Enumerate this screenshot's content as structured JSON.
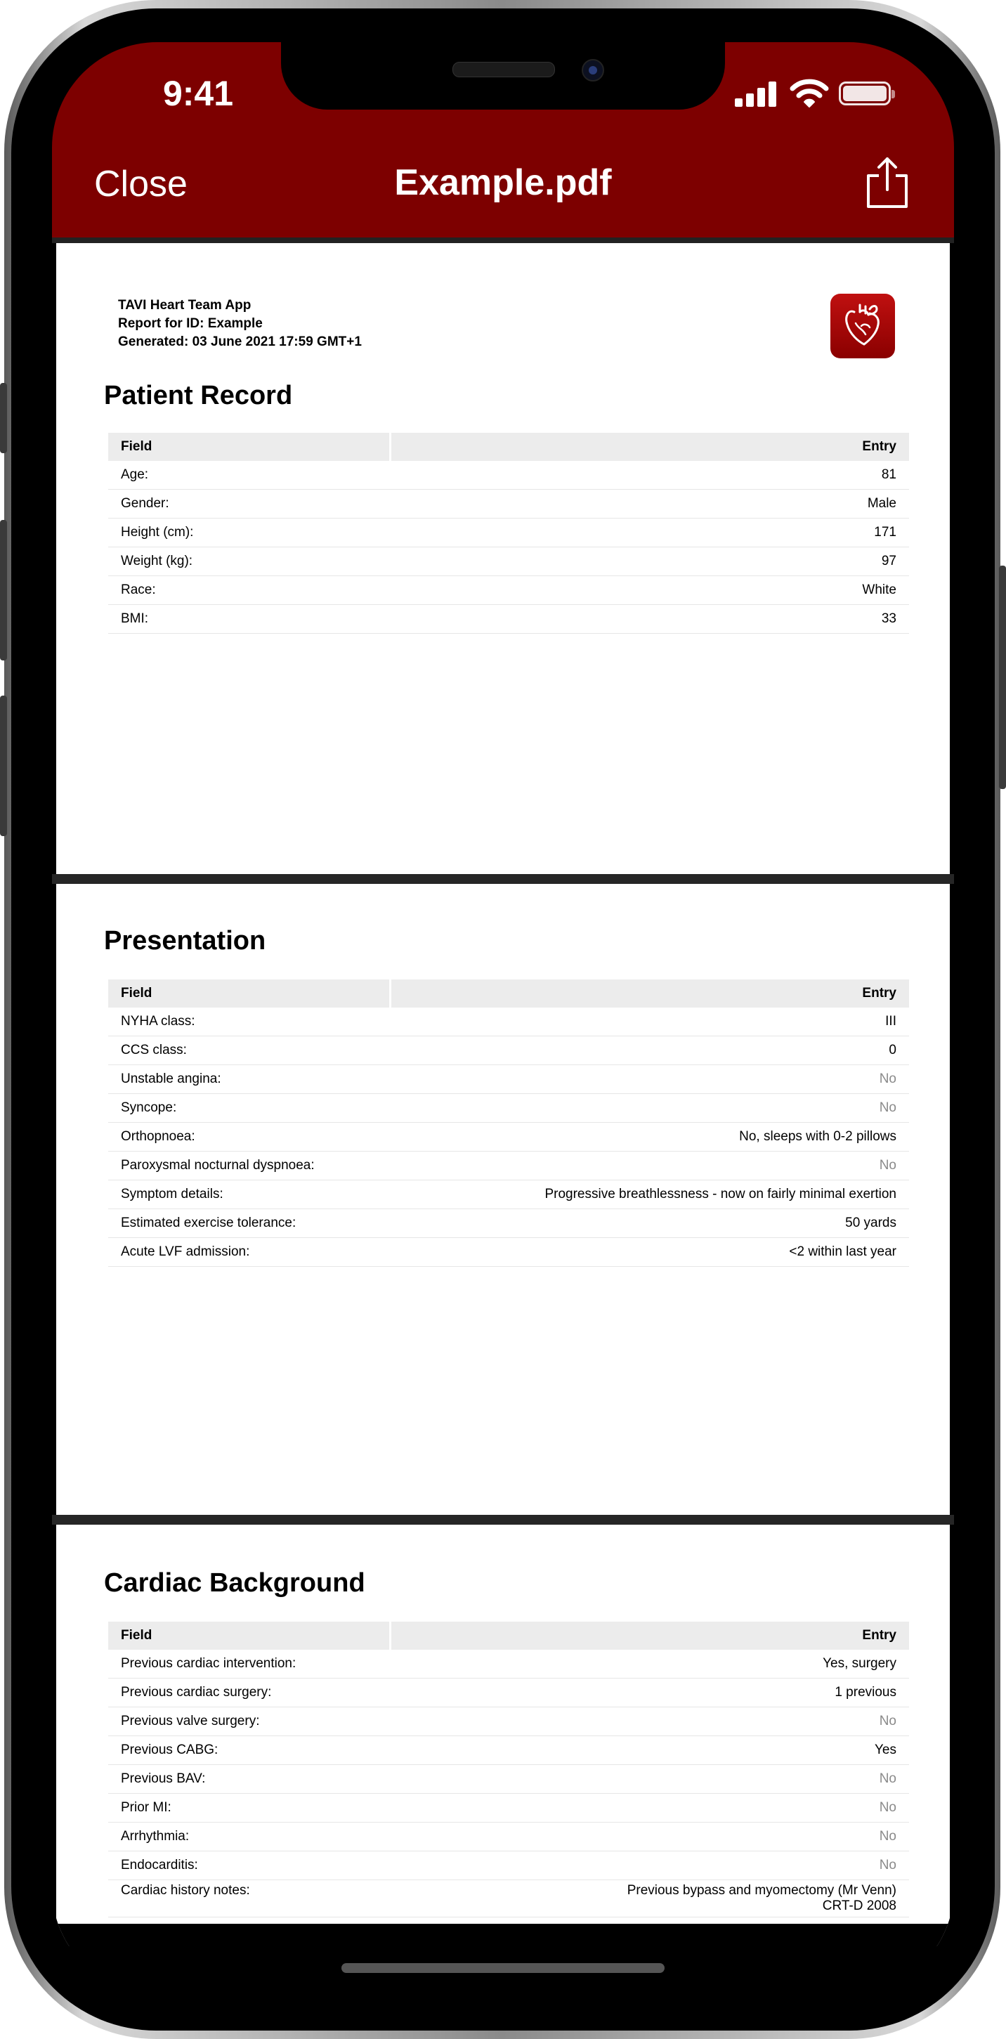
{
  "status_bar": {
    "time": "9:41"
  },
  "nav": {
    "close_label": "Close",
    "title": "Example.pdf"
  },
  "report": {
    "app_name": "TAVI Heart Team App",
    "report_for": "Report for ID: Example",
    "generated": "Generated: 03 June 2021 17:59 GMT+1"
  },
  "columns": {
    "field": "Field",
    "entry": "Entry"
  },
  "sections": [
    {
      "title": "Patient Record",
      "rows": [
        {
          "field": "Age:",
          "entry": "81",
          "muted": false
        },
        {
          "field": "Gender:",
          "entry": "Male",
          "muted": false
        },
        {
          "field": "Height (cm):",
          "entry": "171",
          "muted": false
        },
        {
          "field": "Weight (kg):",
          "entry": "97",
          "muted": false
        },
        {
          "field": "Race:",
          "entry": "White",
          "muted": false
        },
        {
          "field": "BMI:",
          "entry": "33",
          "muted": false
        }
      ]
    },
    {
      "title": "Presentation",
      "rows": [
        {
          "field": "NYHA class:",
          "entry": "III",
          "muted": false
        },
        {
          "field": "CCS class:",
          "entry": "0",
          "muted": false
        },
        {
          "field": "Unstable angina:",
          "entry": "No",
          "muted": true
        },
        {
          "field": "Syncope:",
          "entry": "No",
          "muted": true
        },
        {
          "field": "Orthopnoea:",
          "entry": "No, sleeps with 0-2 pillows",
          "muted": false
        },
        {
          "field": "Paroxysmal nocturnal dyspnoea:",
          "entry": "No",
          "muted": true
        },
        {
          "field": "Symptom details:",
          "entry": "Progressive breathlessness - now on fairly minimal exertion",
          "muted": false
        },
        {
          "field": "Estimated exercise tolerance:",
          "entry": "50 yards",
          "muted": false
        },
        {
          "field": "Acute LVF admission:",
          "entry": "<2 within last year",
          "muted": false
        }
      ]
    },
    {
      "title": "Cardiac Background",
      "rows": [
        {
          "field": "Previous cardiac intervention:",
          "entry": "Yes, surgery",
          "muted": false
        },
        {
          "field": "Previous cardiac surgery:",
          "entry": "1 previous",
          "muted": false
        },
        {
          "field": "Previous valve surgery:",
          "entry": "No",
          "muted": true
        },
        {
          "field": "Previous CABG:",
          "entry": "Yes",
          "muted": false
        },
        {
          "field": "Previous BAV:",
          "entry": "No",
          "muted": true
        },
        {
          "field": "Prior MI:",
          "entry": "No",
          "muted": true
        },
        {
          "field": "Arrhythmia:",
          "entry": "No",
          "muted": true
        },
        {
          "field": "Endocarditis:",
          "entry": "No",
          "muted": true
        },
        {
          "field": "Cardiac history notes:",
          "entry": "Previous bypass and myomectomy (Mr Venn)\nCRT-D 2008",
          "muted": false
        }
      ]
    }
  ],
  "colors": {
    "brand_red": "#7d0000",
    "logo_red": "#c01010",
    "header_bg": "#ececec",
    "muted_text": "#8a8a8a"
  },
  "icons": {
    "share": "share-icon",
    "logo": "heart-logo-icon",
    "signal": "cellular-signal-icon",
    "wifi": "wifi-icon",
    "battery": "battery-icon"
  }
}
